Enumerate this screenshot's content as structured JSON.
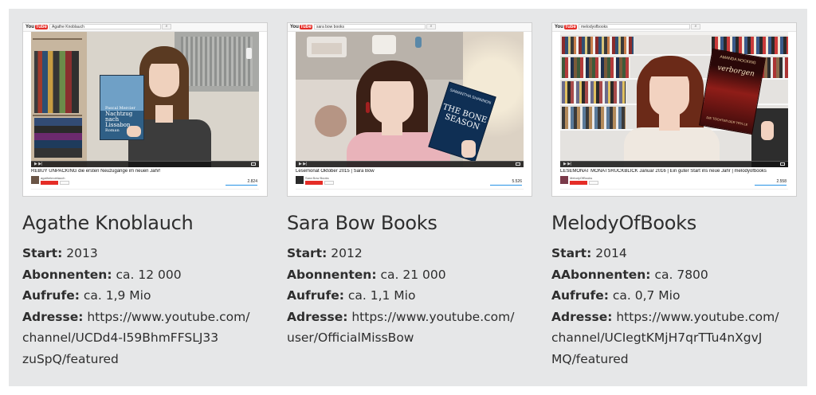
{
  "channels": [
    {
      "video_search": "Agathe Knoblauch",
      "video_title": "REBUY UNPACKING die ersten Neuzugänge im neuen Jahr!",
      "channel_small": "agatheknoblauch",
      "views": "2.824",
      "book_author": "Pascal Mercier",
      "book_title": "Nachtzug nach Lissabon",
      "book_sub": "Roman",
      "name": "Agathe Knoblauch",
      "start_label": "Start:",
      "start": "2013",
      "subs_label": "Abonnenten:",
      "subs": "ca. 12 000",
      "views_label": "Aufrufe:",
      "views_total": "ca. 1,9 Mio",
      "addr_label": "Adresse:",
      "addr_1": "https://www.youtube.com/",
      "addr_2": "channel/UCDd4-I59BhmFFSLJ33",
      "addr_3": "zuSpQ/featured",
      "colors": {
        "bg": "#d7d2c8",
        "hair": "#5a3a22",
        "shirt": "#3c3c3c"
      }
    },
    {
      "video_search": "sara bow books",
      "video_title": "Lesemonat Oktober 2015 | Sara Bow",
      "channel_small": "Sara Bow Books",
      "views": "5.526",
      "book_author": "SAMANTHA SHANNON",
      "book_title": "THE BONE SEASON",
      "book_sub": "",
      "name": "Sara Bow Books",
      "start_label": "Start:",
      "start": "2012",
      "subs_label": "Abonnenten:",
      "subs": "ca. 21 000",
      "views_label": "Aufrufe:",
      "views_total": "ca. 1,1 Mio",
      "addr_label": "Adresse:",
      "addr_1": "https://www.youtube.com/",
      "addr_2": "user/OfficialMissBow",
      "addr_3": "",
      "colors": {
        "bg": "#c9c3bb",
        "hair": "#3b2016",
        "shirt": "#e9b3ba"
      }
    },
    {
      "video_search": "melodyofbooks",
      "video_title": "LESEMONAT MONATSRÜCKBLICK Januar 2016 | Ein guter Start ins neue Jahr | melodyofbooks",
      "channel_small": "MelodyOfBooks",
      "views": "2.558",
      "book_author": "AMANDA HOCKING",
      "book_title": "verborgen",
      "book_sub": "DIE TÖCHTER DER TRYLLE",
      "name": "MelodyOfBooks",
      "start_label": "Start:",
      "start": "2014",
      "subs_label": "AAbonnenten:",
      "subs": "ca. 7800",
      "views_label": "Aufrufe:",
      "views_total": "ca. 0,7 Mio",
      "addr_label": "Adresse:",
      "addr_1": "https://www.youtube.com/",
      "addr_2": "channel/UCIegtKMjH7qrTTu4nXgvJ",
      "addr_3": "MQ/featured",
      "colors": {
        "bg": "#e4e2df",
        "hair": "#6b2a18",
        "shirt": "#efe8e0"
      }
    }
  ],
  "yt": {
    "logo_a": "You",
    "logo_b": "Tube"
  }
}
